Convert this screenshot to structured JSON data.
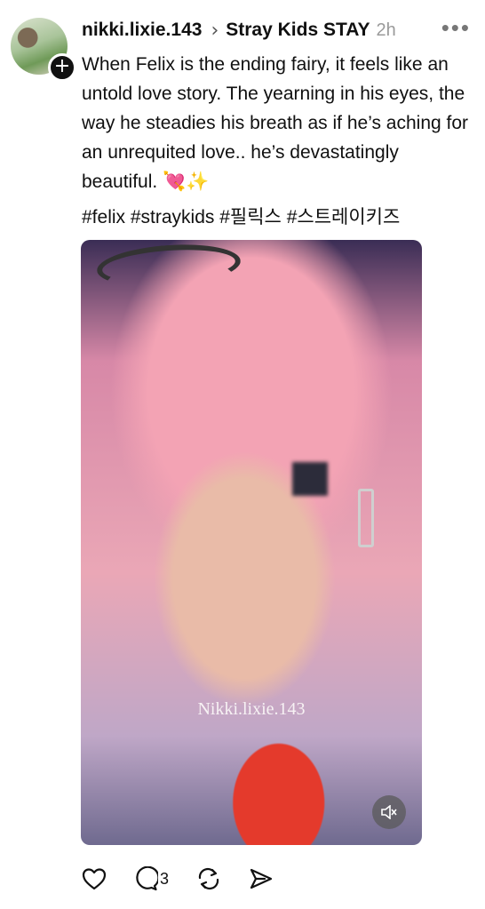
{
  "post": {
    "username": "nikki.lixie.143",
    "community": "Stray Kids STAY",
    "time": "2h",
    "text": "When Felix is the ending fairy, it feels like an untold love story. The yearning in his eyes, the way he steadies his breath as if he’s aching for an unrequited love.. he’s devastatingly beautiful.",
    "emoji_1": "💘",
    "emoji_2": "✨",
    "hashtags": "#felix #straykids #필릭스 #스트레이키즈",
    "media_watermark": "Nikki.lixie.143"
  },
  "actions": {
    "like_icon": "heart-icon",
    "reply_icon": "comment-icon",
    "reply_count": "3",
    "repost_icon": "repost-icon",
    "share_icon": "send-icon"
  },
  "icons": {
    "more": "more-options-icon",
    "chevron": "chevron-right-icon",
    "add": "plus-icon",
    "mute": "muted-speaker-icon"
  },
  "colors": {
    "text": "#101010",
    "muted": "#9a9a9a",
    "accent": "#111111"
  }
}
